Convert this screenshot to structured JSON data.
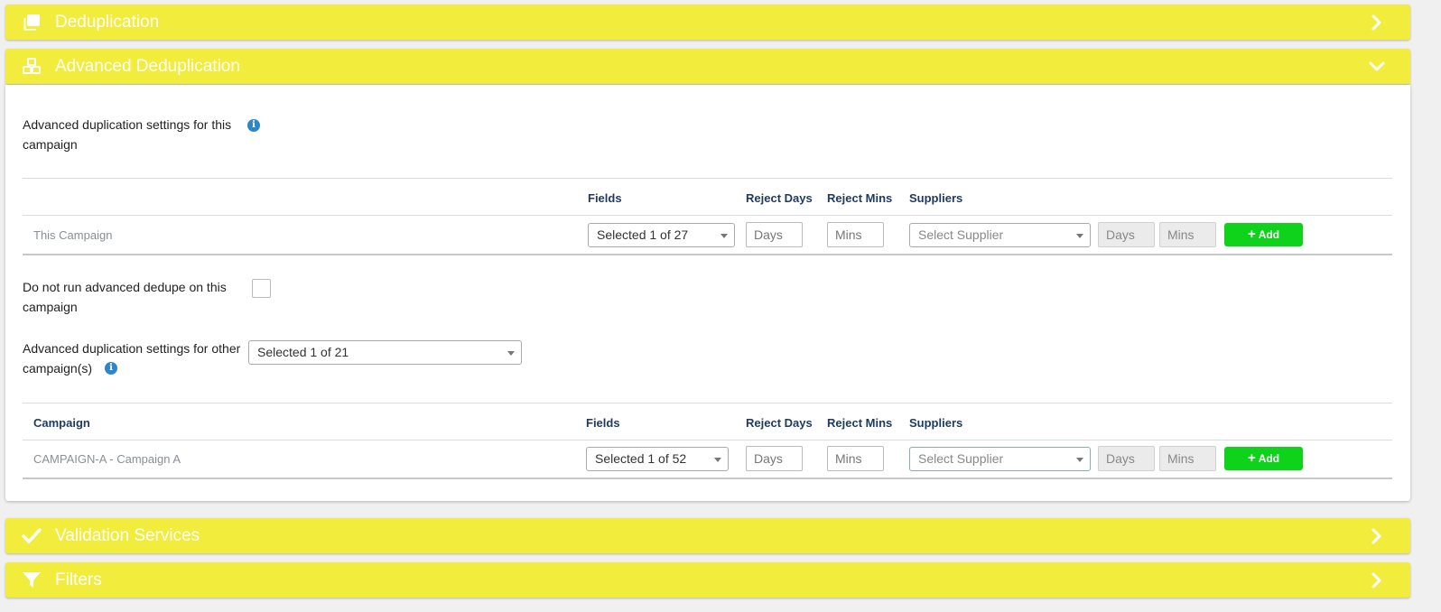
{
  "panels": {
    "deduplication": {
      "title": "Deduplication",
      "icon": "copy-icon"
    },
    "advanced": {
      "title": "Advanced Deduplication",
      "icon": "cubes-icon"
    },
    "validation": {
      "title": "Validation Services",
      "icon": "check-icon"
    },
    "filters": {
      "title": "Filters",
      "icon": "filter-icon"
    }
  },
  "advanced": {
    "this_settings_label": "Advanced duplication settings for this campaign",
    "this_table": {
      "headers": {
        "campaign": "",
        "fields": "Fields",
        "reject_days": "Reject Days",
        "reject_mins": "Reject Mins",
        "suppliers": "Suppliers"
      },
      "row": {
        "campaign": "This Campaign",
        "fields": "Selected 1 of 27",
        "days_placeholder": "Days",
        "mins_placeholder": "Mins",
        "supplier_placeholder": "Select Supplier",
        "sup_days_placeholder": "Days",
        "sup_mins_placeholder": "Mins",
        "add_label": "Add"
      }
    },
    "do_not_run_label": "Do not run advanced dedupe on this campaign",
    "do_not_run_checked": false,
    "other_settings_label": "Advanced duplication settings for other campaign(s)",
    "other_select_value": "Selected 1 of 21",
    "other_table": {
      "headers": {
        "campaign": "Campaign",
        "fields": "Fields",
        "reject_days": "Reject Days",
        "reject_mins": "Reject Mins",
        "suppliers": "Suppliers"
      },
      "row": {
        "campaign": "CAMPAIGN-A - Campaign A",
        "fields": "Selected 1 of 52",
        "days_placeholder": "Days",
        "mins_placeholder": "Mins",
        "supplier_placeholder": "Select Supplier",
        "sup_days_placeholder": "Days",
        "sup_mins_placeholder": "Mins",
        "add_label": "Add"
      }
    }
  },
  "colors": {
    "header_bg": "#f2ec3d",
    "add_button": "#0fd21b",
    "info_icon": "#2f86c6",
    "table_header_text": "#1f3a5f"
  }
}
